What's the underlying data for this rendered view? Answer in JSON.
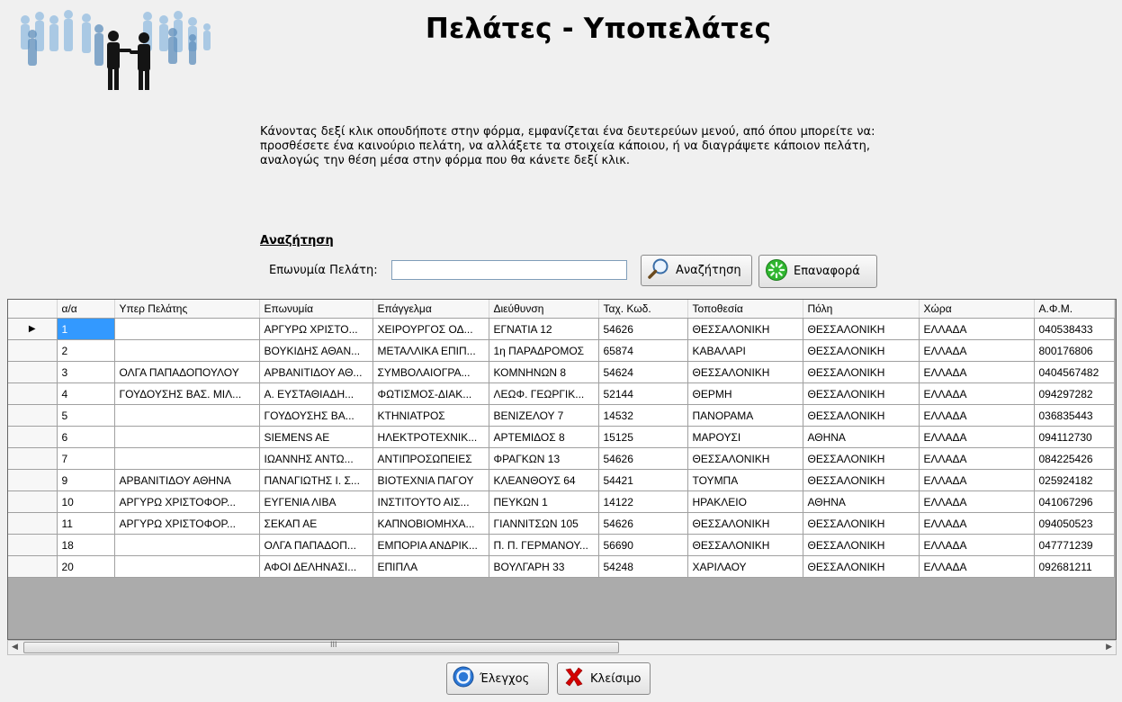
{
  "window": {
    "title": "Πελάτες - Υποπελάτες",
    "info_lines": [
      "Κάνοντας δεξί κλικ οπουδήποτε στην φόρμα, εμφανίζεται ένα δευτερεύων μενού, από όπου μπορείτε να:",
      "προσθέσετε ένα καινούριο πελάτη, να αλλάξετε τα στοιχεία κάποιου, ή να διαγράψετε κάποιον πελάτη,",
      "αναλογώς την θέση μέσα στην φόρμα που θα κάνετε δεξί κλικ."
    ]
  },
  "search": {
    "heading": "Αναζήτηση",
    "label": "Επωνυμία Πελάτη:",
    "value": "",
    "search_button": "Αναζήτηση",
    "reset_button": "Επαναφορά"
  },
  "grid": {
    "columns": [
      "α/α",
      "Υπερ Πελάτης",
      "Επωνυμία",
      "Επάγγελμα",
      "Διεύθυνση",
      "Ταχ. Κωδ.",
      "Τοποθεσία",
      "Πόλη",
      "Χώρα",
      "Α.Φ.Μ."
    ],
    "rows": [
      [
        "1",
        "",
        "ΑΡΓΥΡΩ ΧΡΙΣΤΟ...",
        "ΧΕΙΡΟΥΡΓΟΣ ΟΔ...",
        "ΕΓΝΑΤΙΑ 12",
        "54626",
        "ΘΕΣΣΑΛΟΝΙΚΗ",
        "ΘΕΣΣΑΛΟΝΙΚΗ",
        "ΕΛΛΑΔΑ",
        "040538433"
      ],
      [
        "2",
        "",
        "ΒΟΥΚΙΔΗΣ ΑΘΑΝ...",
        "ΜΕΤΑΛΛΙΚΑ ΕΠΙΠ...",
        "1η ΠΑΡΑΔΡΟΜΟΣ",
        "65874",
        "ΚΑΒΑΛΑΡΙ",
        "ΘΕΣΣΑΛΟΝΙΚΗ",
        "ΕΛΛΑΔΑ",
        "800176806"
      ],
      [
        "3",
        "ΟΛΓΑ ΠΑΠΑΔΟΠΟΥΛΟΥ",
        "ΑΡΒΑΝΙΤΙΔΟΥ ΑΘ...",
        "ΣΥΜΒΟΛΑΙΟΓΡΑ...",
        "ΚΟΜΝΗΝΩΝ 8",
        "54624",
        "ΘΕΣΣΑΛΟΝΙΚΗ",
        "ΘΕΣΣΑΛΟΝΙΚΗ",
        "ΕΛΛΑΔΑ",
        "0404567482"
      ],
      [
        "4",
        "ΓΟΥΔΟΥΣΗΣ ΒΑΣ. ΜΙΛ...",
        "Α. ΕΥΣΤΑΘΙΑΔΗ...",
        "ΦΩΤΙΣΜΟΣ-ΔΙΑΚ...",
        "ΛΕΩΦ. ΓΕΩΡΓΙΚ...",
        "52144",
        "ΘΕΡΜΗ",
        "ΘΕΣΣΑΛΟΝΙΚΗ",
        "ΕΛΛΑΔΑ",
        "094297282"
      ],
      [
        "5",
        "",
        "ΓΟΥΔΟΥΣΗΣ ΒΑ...",
        "ΚΤΗΝΙΑΤΡΟΣ",
        "ΒΕΝΙΖΕΛΟΥ 7",
        "14532",
        "ΠΑΝΟΡΑΜΑ",
        "ΘΕΣΣΑΛΟΝΙΚΗ",
        "ΕΛΛΑΔΑ",
        "036835443"
      ],
      [
        "6",
        "",
        "SIEMENS AE",
        "ΗΛΕΚΤΡΟΤΕΧΝΙΚ...",
        "ΑΡΤΕΜΙΔΟΣ 8",
        "15125",
        "ΜΑΡΟΥΣΙ",
        "ΑΘΗΝΑ",
        "ΕΛΛΑΔΑ",
        "094112730"
      ],
      [
        "7",
        "",
        "ΙΩΑΝΝΗΣ ΑΝΤΩ...",
        "ΑΝΤΙΠΡΟΣΩΠΕΙΕΣ",
        "ΦΡΑΓΚΩΝ 13",
        "54626",
        "ΘΕΣΣΑΛΟΝΙΚΗ",
        "ΘΕΣΣΑΛΟΝΙΚΗ",
        "ΕΛΛΑΔΑ",
        "084225426"
      ],
      [
        "9",
        "ΑΡΒΑΝΙΤΙΔΟΥ ΑΘΗΝΑ",
        "ΠΑΝΑΓΙΩΤΗΣ Ι. Σ...",
        "ΒΙΟΤΕΧΝΙΑ ΠΑΓΟΥ",
        "ΚΛΕΑΝΘΟΥΣ 64",
        "54421",
        "ΤΟΥΜΠΑ",
        "ΘΕΣΣΑΛΟΝΙΚΗ",
        "ΕΛΛΑΔΑ",
        "025924182"
      ],
      [
        "10",
        "ΑΡΓΥΡΩ ΧΡΙΣΤΟΦΟΡ...",
        "ΕΥΓΕΝΙΑ ΛΙΒΑ",
        "ΙΝΣΤΙΤΟΥΤΟ ΑΙΣ...",
        "ΠΕΥΚΩΝ 1",
        "14122",
        "ΗΡΑΚΛΕΙΟ",
        "ΑΘΗΝΑ",
        "ΕΛΛΑΔΑ",
        "041067296"
      ],
      [
        "11",
        "ΑΡΓΥΡΩ ΧΡΙΣΤΟΦΟΡ...",
        "ΣΕΚΑΠ ΑΕ",
        "ΚΑΠΝΟΒΙΟΜΗΧΑ...",
        "ΓΙΑΝΝΙΤΣΩΝ 105",
        "54626",
        "ΘΕΣΣΑΛΟΝΙΚΗ",
        "ΘΕΣΣΑΛΟΝΙΚΗ",
        "ΕΛΛΑΔΑ",
        "094050523"
      ],
      [
        "18",
        "",
        "ΟΛΓΑ ΠΑΠΑΔΟΠ...",
        "ΕΜΠΟΡΙΑ ΑΝΔΡΙΚ...",
        "Π. Π. ΓΕΡΜΑΝΟΥ...",
        "56690",
        "ΘΕΣΣΑΛΟΝΙΚΗ",
        "ΘΕΣΣΑΛΟΝΙΚΗ",
        "ΕΛΛΑΔΑ",
        "047771239"
      ],
      [
        "20",
        "",
        "ΑΦΟΙ ΔΕΛΗΝΑΣΙ...",
        "ΕΠΙΠΛΑ",
        "ΒΟΥΛΓΑΡΗ 33",
        "54248",
        "ΧΑΡΙΛΑΟΥ",
        "ΘΕΣΣΑΛΟΝΙΚΗ",
        "ΕΛΛΑΔΑ",
        "092681211"
      ]
    ],
    "current_row_marker": "▶",
    "scroll_grip": "III"
  },
  "footer": {
    "check_button": "Έλεγχος",
    "close_button": "Κλείσιμο"
  },
  "colors": {
    "selection": "#3399ff",
    "background": "#f0f0f0",
    "close_x": "#d40000",
    "reset_icon": "#2fb52f",
    "check_icon": "#2c78d6"
  },
  "icons": [
    "people-logo-icon",
    "magnifier-icon",
    "refresh-icon",
    "check-icon",
    "close-x-icon"
  ]
}
